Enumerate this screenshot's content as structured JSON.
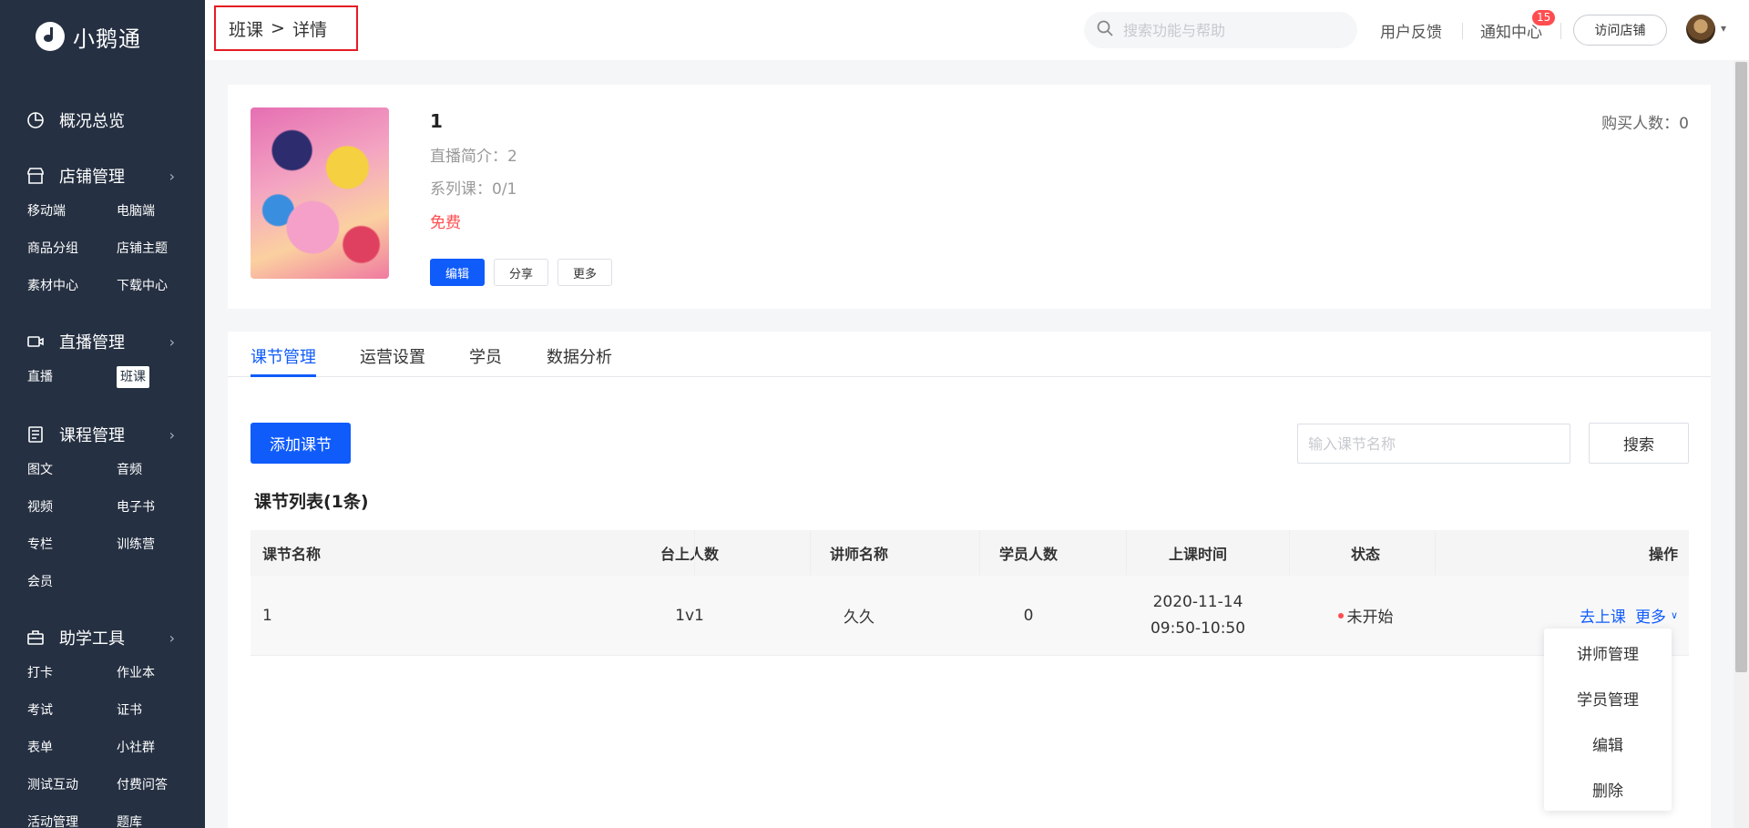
{
  "app": {
    "logo_text": "小鹅通"
  },
  "sidebar": {
    "groups": [
      {
        "label": "概况总览",
        "icon": "pie-chart-icon",
        "chevron": false,
        "items": []
      },
      {
        "label": "店铺管理",
        "icon": "store-icon",
        "chevron": true,
        "items": [
          "移动端",
          "电脑端",
          "商品分组",
          "店铺主题",
          "素材中心",
          "下载中心"
        ]
      },
      {
        "label": "直播管理",
        "icon": "video-camera-icon",
        "chevron": true,
        "items": [
          "直播",
          "班课"
        ],
        "active_item": "班课"
      },
      {
        "label": "课程管理",
        "icon": "book-icon",
        "chevron": true,
        "items": [
          "图文",
          "音频",
          "视频",
          "电子书",
          "专栏",
          "训练营",
          "会员"
        ]
      },
      {
        "label": "助学工具",
        "icon": "toolbox-icon",
        "chevron": true,
        "items": [
          "打卡",
          "作业本",
          "考试",
          "证书",
          "表单",
          "小社群",
          "测试互动",
          "付费问答",
          "活动管理",
          "题库"
        ]
      }
    ]
  },
  "topbar": {
    "breadcrumb": {
      "parent": "班课",
      "separator": ">",
      "current": "详情"
    },
    "search_placeholder": "搜索功能与帮助",
    "feedback": "用户反馈",
    "notifications": "通知中心",
    "notification_count": "15",
    "visit_store": "访问店铺"
  },
  "course": {
    "title": "1",
    "live_intro": "直播简介：2",
    "series": "系列课：0/1",
    "price": "免费",
    "buyers": "购买人数：0",
    "buttons": {
      "edit": "编辑",
      "share": "分享",
      "more": "更多"
    }
  },
  "tabs": [
    "课节管理",
    "运营设置",
    "学员",
    "数据分析"
  ],
  "active_tab": "课节管理",
  "lessons": {
    "add_button": "添加课节",
    "search_placeholder": "输入课节名称",
    "search_button": "搜索",
    "list_title": "课节列表(1条)",
    "columns": [
      "课节名称",
      "台上人数",
      "讲师名称",
      "学员人数",
      "上课时间",
      "状态",
      "操作"
    ],
    "rows": [
      {
        "name": "1",
        "stage_count": "1v1",
        "teacher": "久久",
        "students": "0",
        "date": "2020-11-14",
        "time": "09:50-10:50",
        "status": "未开始",
        "go_class": "去上课",
        "more": "更多"
      }
    ],
    "more_menu": [
      "讲师管理",
      "学员管理",
      "编辑",
      "删除"
    ]
  },
  "colors": {
    "primary": "#105cfb",
    "sidebar_bg": "#253042",
    "danger": "#ff4d4f"
  }
}
